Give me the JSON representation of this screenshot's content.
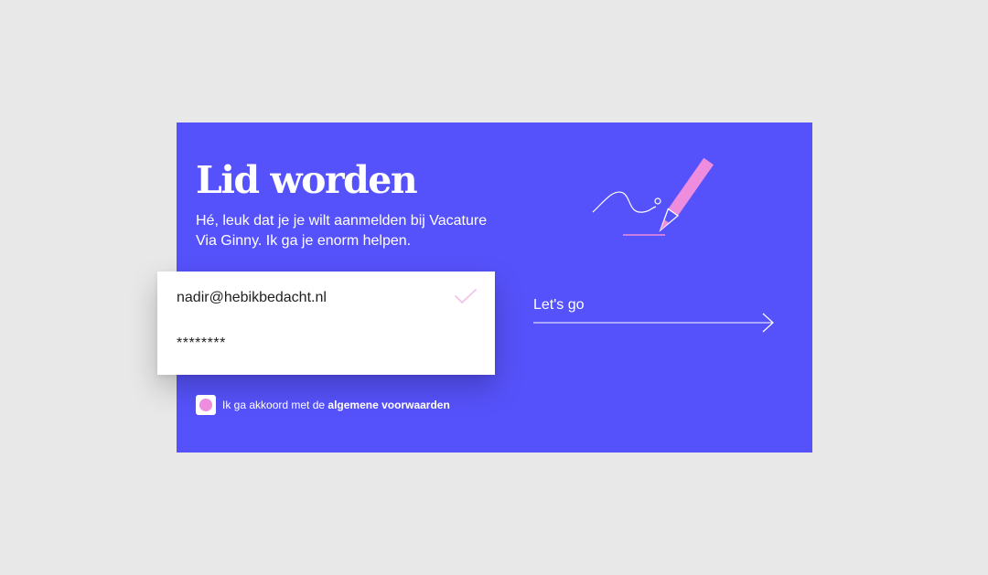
{
  "signup": {
    "title": "Lid worden",
    "subtitle": "Hé, leuk dat je je wilt aanmelden bij Vacature Via Ginny. Ik ga je enorm helpen.",
    "email_value": "nadir@hebikbedacht.nl",
    "password_value": "********",
    "submit_label": "Let's go",
    "terms_prefix": "Ik ga akkoord met de",
    "terms_link": "algemene voorwaarden",
    "terms_checked": true
  },
  "icons": {
    "valid": "check-icon",
    "submit": "arrow-right-icon",
    "illustration": "pencil-icon"
  },
  "colors": {
    "page_background": "#e8e8e8",
    "card_background": "#5652fb",
    "accent_pink": "#ee8ddd",
    "text_light": "#ffffff",
    "text_dark": "#1f1f1f"
  }
}
